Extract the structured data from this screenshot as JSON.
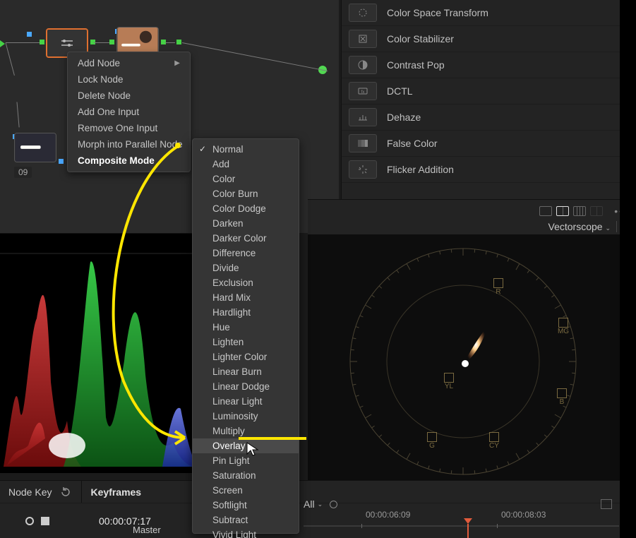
{
  "node_graph": {
    "node_labels": {
      "n09": "09"
    }
  },
  "context_menu": {
    "items": [
      {
        "label": "Add Node",
        "has_sub": true
      },
      {
        "label": "Lock Node"
      },
      {
        "label": "Delete Node"
      },
      {
        "label": "Add One Input"
      },
      {
        "label": "Remove One Input"
      },
      {
        "label": "Morph into Parallel Node"
      },
      {
        "label": "Composite Mode",
        "highlight": true,
        "has_sub": true
      }
    ]
  },
  "composite_submenu": {
    "checked": "Normal",
    "highlighted": "Overlay",
    "items": [
      "Normal",
      "Add",
      "Color",
      "Color Burn",
      "Color Dodge",
      "Darken",
      "Darker Color",
      "Difference",
      "Divide",
      "Exclusion",
      "Hard Mix",
      "Hardlight",
      "Hue",
      "Lighten",
      "Lighter Color",
      "Linear Burn",
      "Linear Dodge",
      "Linear Light",
      "Luminosity",
      "Multiply",
      "Overlay",
      "Pin Light",
      "Saturation",
      "Screen",
      "Softlight",
      "Subtract",
      "Vivid Light"
    ]
  },
  "effects_panel": {
    "items": [
      "Color Space Transform",
      "Color Stabilizer",
      "Contrast Pop",
      "DCTL",
      "Dehaze",
      "False Color",
      "Flicker Addition"
    ]
  },
  "scope_bar": {
    "dropdown_label": "Vectorscope",
    "options_ellipsis": "•••"
  },
  "vectorscope": {
    "targets": [
      "R",
      "MG",
      "B",
      "CY",
      "G",
      "YL"
    ]
  },
  "bottom_panel": {
    "node_key_label": "Node Key",
    "keyframes_label": "Keyframes",
    "timecode": "00:00:07:17",
    "master_label": "Master",
    "all_label": "All",
    "timeline_tcs": [
      "00:00:06:09",
      "00:00:08:03"
    ]
  }
}
